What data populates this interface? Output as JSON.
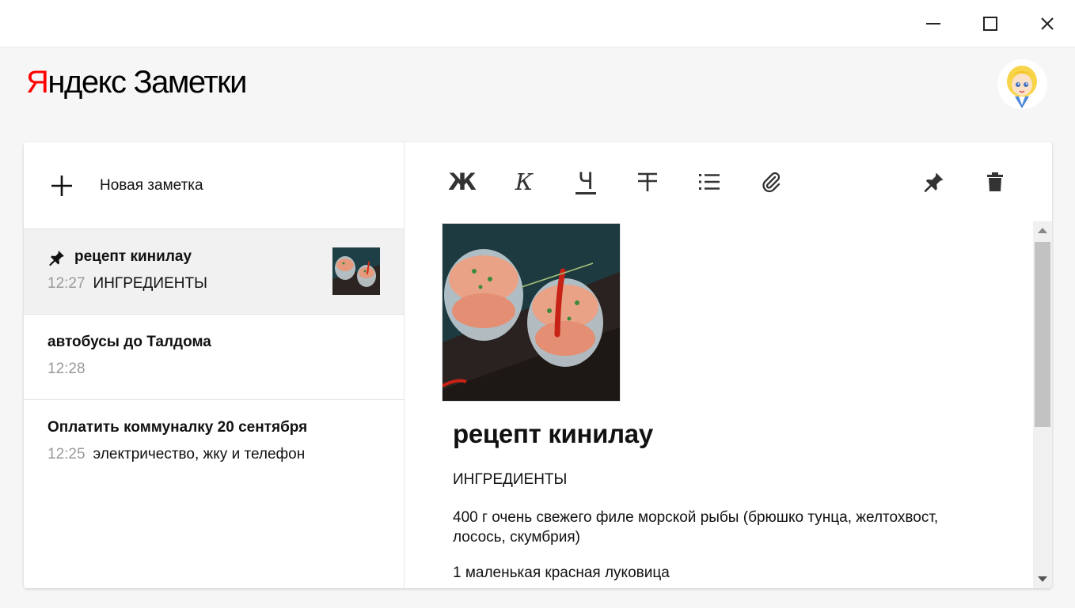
{
  "header": {
    "logo_brand": "Яндекс",
    "logo_product": "Заметки",
    "avatar": "alice-avatar"
  },
  "window": {
    "buttons": [
      "minimize-icon",
      "maximize-icon",
      "close-icon"
    ]
  },
  "sidebar": {
    "new_note_label": "Новая заметка",
    "notes": [
      {
        "title": "рецепт кинилау",
        "time": "12:27",
        "preview": "ИНГРЕДИЕНТЫ",
        "pinned": true,
        "has_image": true
      },
      {
        "title": "автобусы до Талдома",
        "time": "12:28",
        "preview": "",
        "pinned": false,
        "has_image": false
      },
      {
        "title": "Оплатить коммуналку 20 сентября",
        "time": "12:25",
        "preview": "электричество, жку и телефон",
        "pinned": false,
        "has_image": false
      }
    ]
  },
  "toolbar": {
    "bold": "Ж",
    "italic": "К",
    "underline": "Ч",
    "strike_icon": "strikethrough-icon",
    "list_icon": "list-icon",
    "attach_icon": "paperclip-icon",
    "pin_icon": "pin-icon",
    "trash_icon": "trash-icon"
  },
  "editor": {
    "title": "рецепт кинилау",
    "paragraphs": [
      "ИНГРЕДИЕНТЫ",
      "400 г очень свежего филе морской рыбы (брюшко тунца, желтохвост, лосось, скумбрия)",
      "1 маленькая красная луковица"
    ]
  },
  "colors": {
    "brand_red": "#ff0000",
    "active_note_bg": "#f1f1f1",
    "time_gray": "#9a9a9a"
  }
}
